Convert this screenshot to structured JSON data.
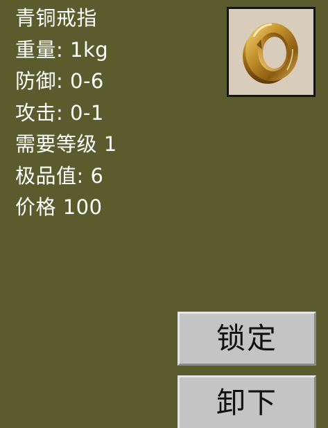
{
  "item": {
    "name": "青铜戒指",
    "icon": "bronze-ring-icon",
    "stats": [
      "重量: 1kg",
      "防御: 0-6",
      "攻击: 0-1",
      "需要等级 1",
      "极品值: 6",
      "价格 100"
    ]
  },
  "actions": {
    "lock_label": "锁定",
    "unequip_label": "卸下"
  },
  "colors": {
    "panel_background": "#5b5c2d",
    "text": "#ffffff",
    "button_face": "#c4c4c4",
    "item_slot_background": "#d8cdbb"
  }
}
